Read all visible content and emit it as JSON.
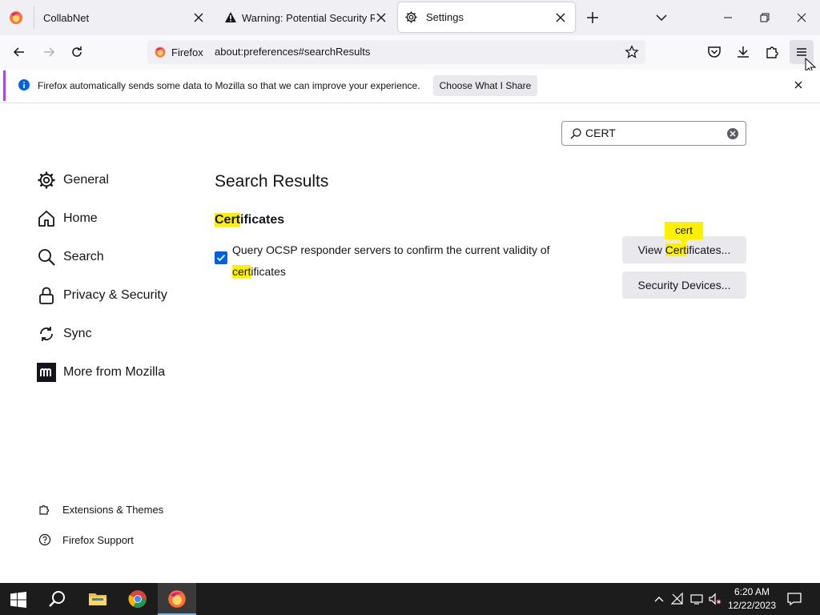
{
  "tabs": [
    {
      "label": "CollabNet"
    },
    {
      "label": "Warning: Potential Security Risk Ahead"
    },
    {
      "label": "Settings"
    }
  ],
  "navbar": {
    "identity_label": "Firefox",
    "url": "about:preferences#searchResults"
  },
  "notification": {
    "message": "Firefox automatically sends some data to Mozilla so that we can improve your experience.",
    "button": "Choose What I Share"
  },
  "search": {
    "value": "CERT"
  },
  "sidebar": {
    "items": [
      {
        "label": "General",
        "icon": "gear-icon"
      },
      {
        "label": "Home",
        "icon": "home-icon"
      },
      {
        "label": "Search",
        "icon": "search-icon"
      },
      {
        "label": "Privacy & Security",
        "icon": "lock-icon"
      },
      {
        "label": "Sync",
        "icon": "sync-icon"
      },
      {
        "label": "More from Mozilla",
        "icon": "mozilla-icon"
      }
    ],
    "footer": [
      {
        "label": "Extensions & Themes",
        "icon": "puzzle-icon"
      },
      {
        "label": "Firefox Support",
        "icon": "help-icon"
      }
    ]
  },
  "main": {
    "title": "Search Results",
    "section_hl": "Cert",
    "section_rest": "ificates",
    "ocsp_pre": "Query OCSP responder servers to confirm the current validity of ",
    "ocsp_hl": "cert",
    "ocsp_post": "ificates",
    "view_btn_pre": "View ",
    "view_btn_hl": "Cert",
    "view_btn_post": "ificates...",
    "security_devices_btn": "Security Devices...",
    "tooltip": "cert"
  },
  "taskbar": {
    "time": "6:20 AM",
    "date": "12/22/2023"
  },
  "colors": {
    "accent": "#0061e0",
    "highlight": "#fff000",
    "notif_bar": "#a34ed8"
  }
}
